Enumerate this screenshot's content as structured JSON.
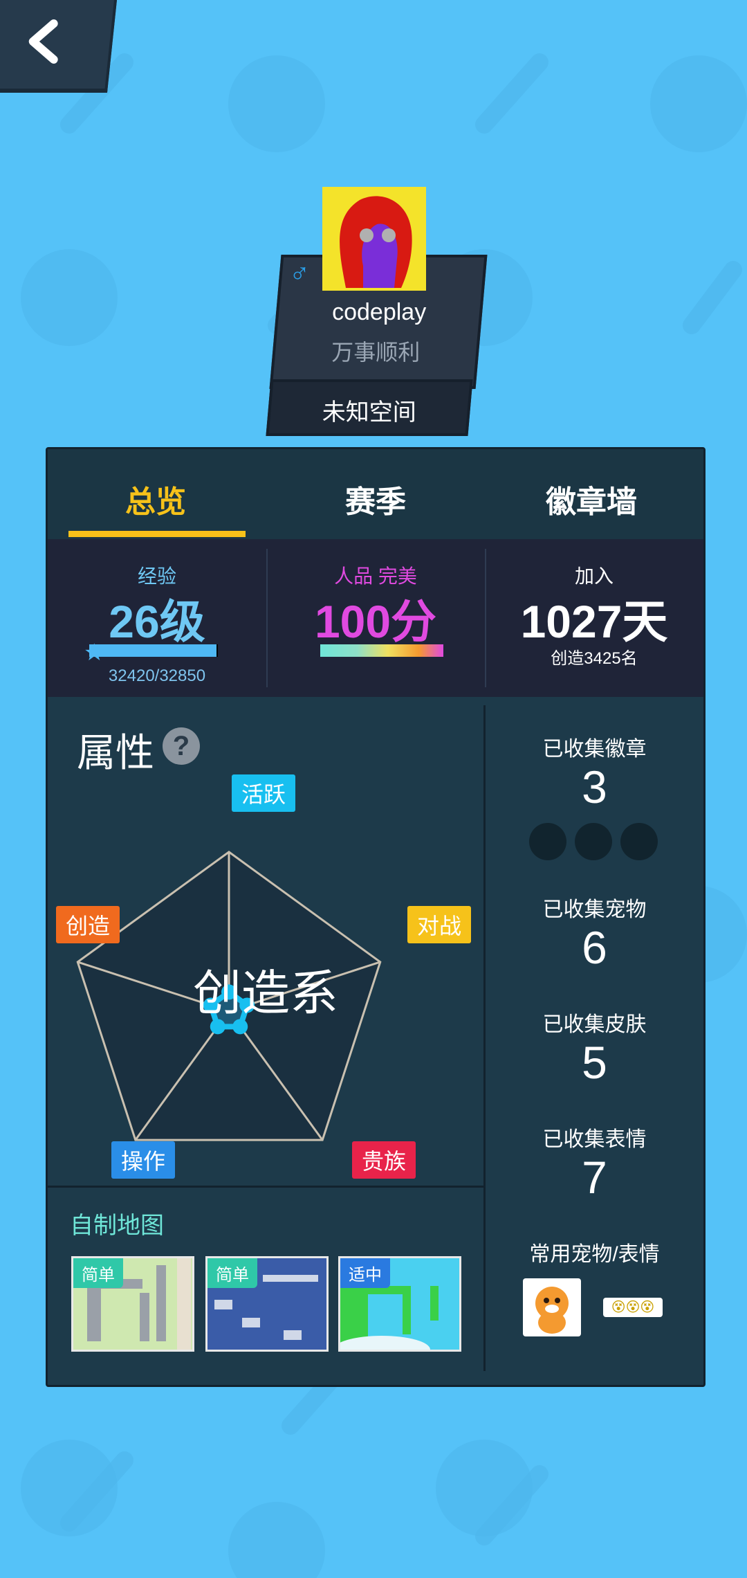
{
  "back_icon": "chevron-left-icon",
  "profile": {
    "name": "codeplay",
    "motto": "万事顺利",
    "space": "未知空间",
    "gender_symbol": "♂"
  },
  "tabs": [
    {
      "label": "总览",
      "active": true
    },
    {
      "label": "赛季",
      "active": false
    },
    {
      "label": "徽章墙",
      "active": false
    }
  ],
  "stats": {
    "exp_label": "经验",
    "level": "26级",
    "exp_value": "32420/32850",
    "exp_progress": 0.987,
    "char_label": "人品 完美",
    "char_value": "100分",
    "join_label": "加入",
    "join_value": "1027天",
    "create_rank": "创造3425名"
  },
  "attributes": {
    "title": "属性",
    "help": "?",
    "labels": {
      "active": "活跃",
      "create": "创造",
      "battle": "对战",
      "operate": "操作",
      "noble": "贵族"
    },
    "center_text": "创造系",
    "levels": {
      "active": 0.12,
      "battle": 0.12,
      "noble": 0.12,
      "operate": 0.12,
      "create": 0.12
    }
  },
  "maps": {
    "title": "自制地图",
    "items": [
      {
        "difficulty": "简单",
        "badge_color": "#2fc8a8"
      },
      {
        "difficulty": "简单",
        "badge_color": "#2fc8a8"
      },
      {
        "difficulty": "适中",
        "badge_color": "#2a7ae0"
      }
    ]
  },
  "collection": {
    "badges_label": "已收集徽章",
    "badges_value": "3",
    "pets_label": "已收集宠物",
    "pets_value": "6",
    "skins_label": "已收集皮肤",
    "skins_value": "5",
    "emotes_label": "已收集表情",
    "emotes_value": "7",
    "fav_label": "常用宠物/表情",
    "emote_text": "😵😵😵"
  },
  "colors": {
    "background": "#55c2f8",
    "accent": "#f6c21a",
    "panel": "#1d3a4a",
    "exp": "#4fb8f4",
    "char": "#e04ae0",
    "tag_active": "#18bff0",
    "tag_create": "#f06a1e",
    "tag_battle": "#f6c21a",
    "tag_operate": "#2a8ee8",
    "tag_noble": "#e8234a"
  }
}
